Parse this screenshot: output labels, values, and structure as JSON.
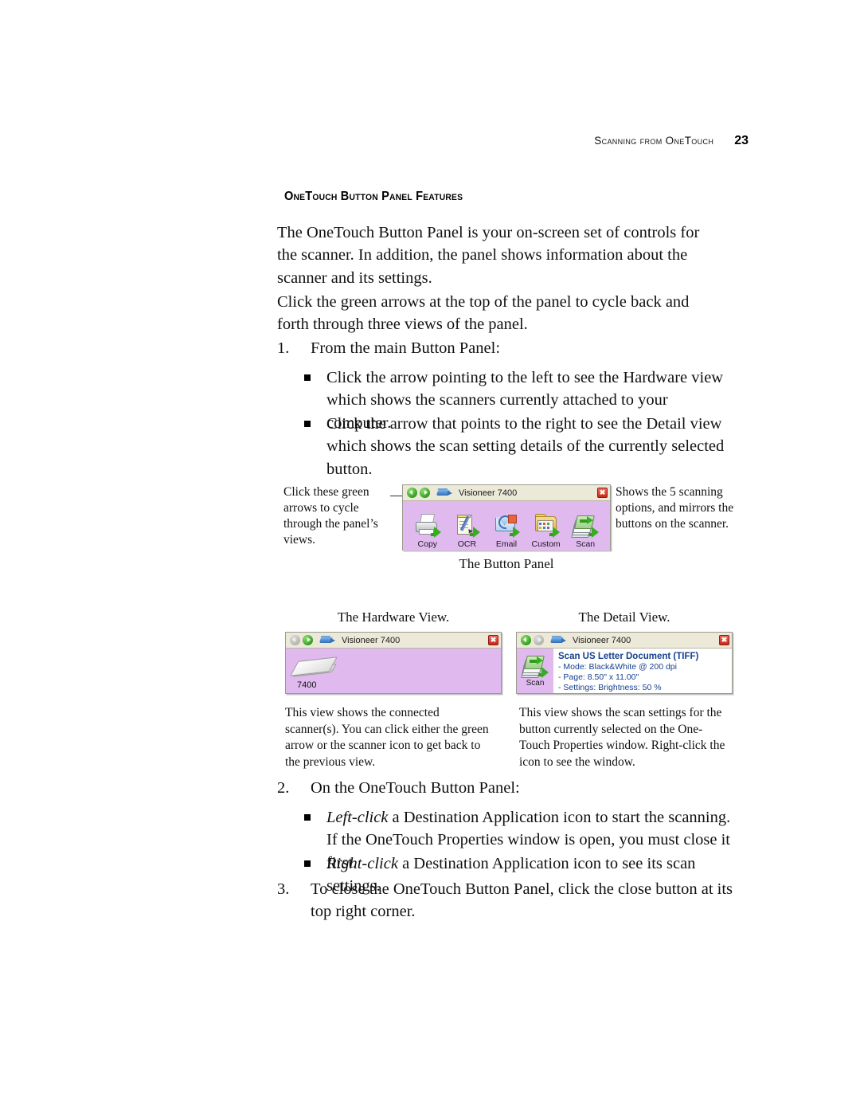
{
  "header": {
    "running_head": "Scanning from OneTouch",
    "page_number": "23"
  },
  "section": {
    "heading": "OneTouch Button Panel Features",
    "paragraphs": [
      "The OneTouch Button Panel is your on-screen set of controls for the scanner. In addition, the panel shows information about the scanner and its settings.",
      "Click the green arrows at the top of the panel to cycle back and forth through three views of the panel."
    ]
  },
  "steps": [
    {
      "number": "1.",
      "text": "From the main Button Panel:"
    },
    {
      "number": "2.",
      "text": "On the OneTouch Button Panel:"
    },
    {
      "number": "3.",
      "text": "To close the OneTouch Button Panel, click the close button at its top right corner."
    }
  ],
  "bullets_step1": [
    "Click the arrow pointing to the left to see the Hardware view which shows the scanners currently attached to your computer.",
    "Click the arrow that points to the right to see the Detail view which shows the scan setting details of the currently selected button."
  ],
  "bullets_step2": [
    {
      "lead": "Left-click",
      "rest": " a Destination Application icon to start the scanning. If the OneTouch Properties window is open, you must close it first."
    },
    {
      "lead": "Right-click",
      "rest": " a Destination Application icon to see its scan settings."
    }
  ],
  "figure_main": {
    "annotation_left": "Click these green arrows to cycle through the panel’s views.",
    "annotation_right": "Shows the 5 scanning options, and mirrors the buttons on the scanner.",
    "caption": "The Button Panel",
    "panel": {
      "title": "Visioneer 7400",
      "close_label": "✖",
      "buttons": [
        {
          "label": "Copy",
          "icon": "printer-icon"
        },
        {
          "label": "OCR",
          "icon": "notepad-pen-icon"
        },
        {
          "label": "Email",
          "icon": "email-icon"
        },
        {
          "label": "Custom",
          "icon": "folder-icon"
        },
        {
          "label": "Scan",
          "icon": "scan-stack-icon"
        }
      ]
    }
  },
  "figure_hardware": {
    "title": "The Hardware View.",
    "panel": {
      "title": "Visioneer 7400",
      "device_label": "7400"
    },
    "note": "This view shows the connected scanner(s). You can click either the green arrow or the scanner icon to get back to the previous view."
  },
  "figure_detail": {
    "title": "The Detail View.",
    "panel": {
      "title": "Visioneer  7400",
      "icon_label": "Scan",
      "heading": "Scan US Letter Document (TIFF)",
      "lines": [
        "- Mode: Black&White @ 200 dpi",
        "- Page:  8.50\" x 11.00\"",
        "- Settings: Brightness: 50 %"
      ]
    },
    "note": "This view shows the scan settings for the button currently selected on the One-Touch Properties window. Right-click the icon to see the window."
  },
  "colors": {
    "panel_body": "#E0B9EF",
    "panel_title_bar": "#ECE9D8",
    "arrow_green": "#2F9E1C",
    "arrow_grey": "#B4B4AD",
    "close_red": "#C8281A",
    "detail_text_blue": "#16408F"
  }
}
